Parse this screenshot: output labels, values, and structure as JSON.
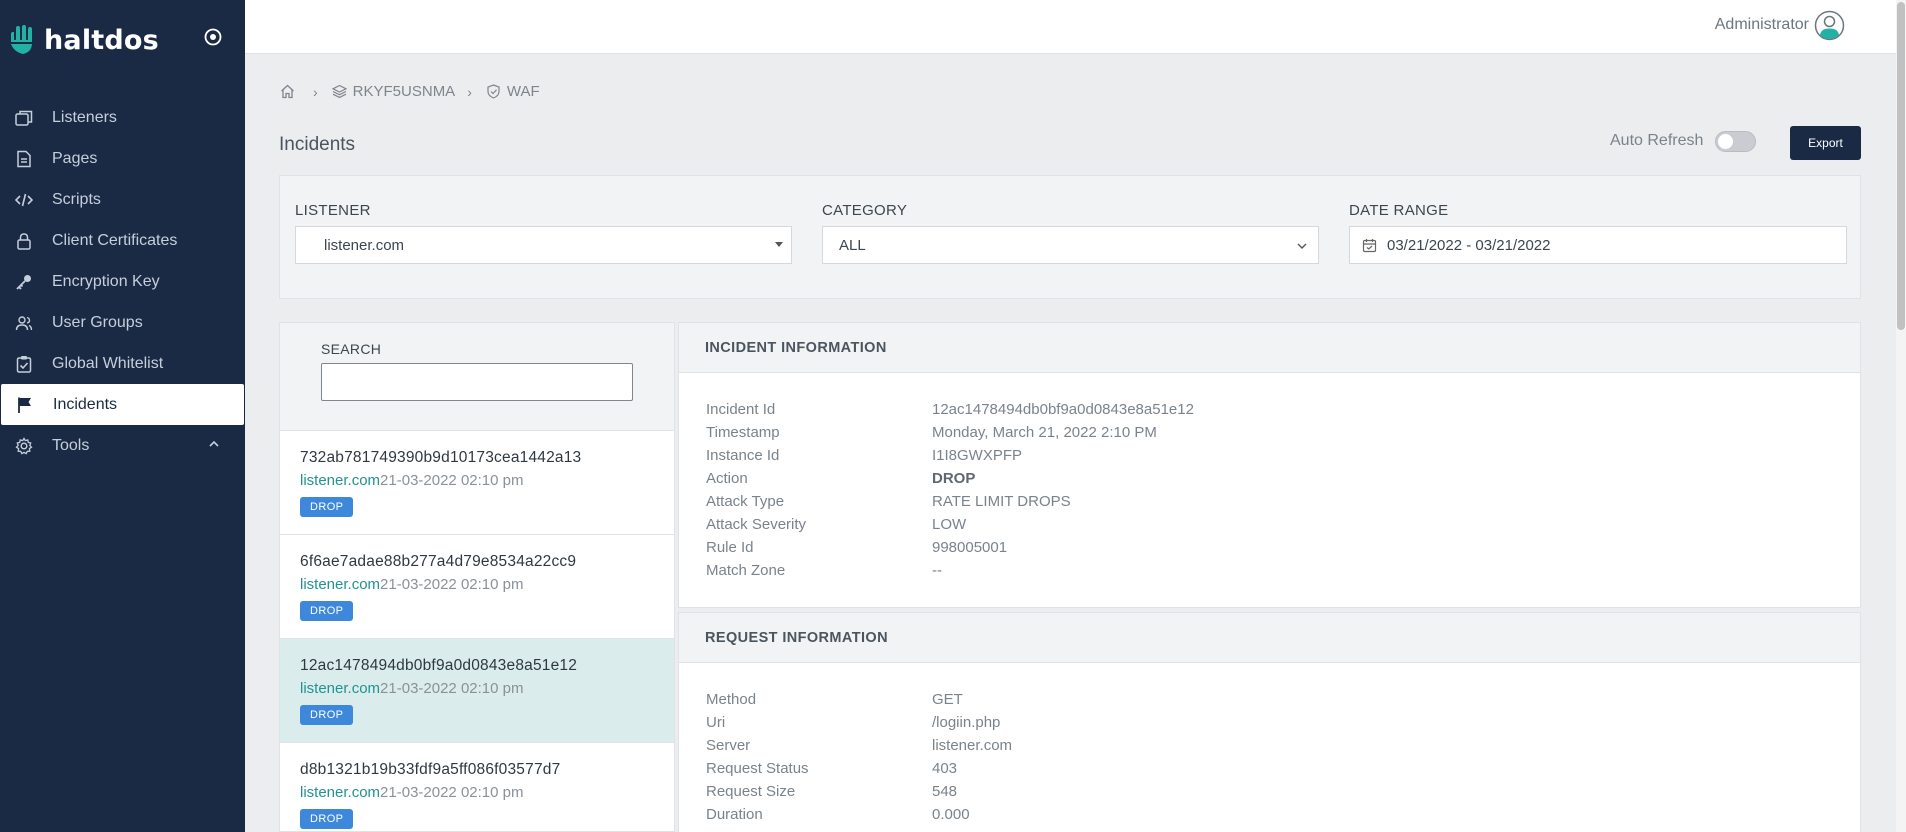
{
  "app": {
    "brand": "haltdos"
  },
  "sidebar": {
    "items": [
      {
        "label": "Listeners",
        "icon": "layers-window-icon"
      },
      {
        "label": "Pages",
        "icon": "document-icon"
      },
      {
        "label": "Scripts",
        "icon": "code-icon"
      },
      {
        "label": "Client Certificates",
        "icon": "lock-icon"
      },
      {
        "label": "Encryption Key",
        "icon": "key-icon"
      },
      {
        "label": "User Groups",
        "icon": "users-icon"
      },
      {
        "label": "Global Whitelist",
        "icon": "clipboard-check-icon"
      },
      {
        "label": "Incidents",
        "icon": "flag-icon",
        "active": true
      },
      {
        "label": "Tools",
        "icon": "gear-icon"
      }
    ]
  },
  "header": {
    "user": "Administrator"
  },
  "breadcrumb": {
    "home": "home-icon",
    "instance": "RKYF5USNMA",
    "section": "WAF"
  },
  "page": {
    "title": "Incidents",
    "auto_refresh_label": "Auto Refresh",
    "auto_refresh_on": false,
    "export_label": "Export"
  },
  "filters": {
    "listener": {
      "label": "LISTENER",
      "value": "listener.com"
    },
    "category": {
      "label": "CATEGORY",
      "value": "ALL"
    },
    "date_range": {
      "label": "DATE RANGE",
      "value": "03/21/2022 - 03/21/2022"
    }
  },
  "search": {
    "label": "SEARCH",
    "value": ""
  },
  "incidents": [
    {
      "id": "732ab781749390b9d10173cea1442a13",
      "host": "listener.com",
      "time": "21-03-2022 02:10 pm",
      "action": "DROP"
    },
    {
      "id": "6f6ae7adae88b277a4d79e8534a22cc9",
      "host": "listener.com",
      "time": "21-03-2022 02:10 pm",
      "action": "DROP"
    },
    {
      "id": "12ac1478494db0bf9a0d0843e8a51e12",
      "host": "listener.com",
      "time": "21-03-2022 02:10 pm",
      "action": "DROP",
      "selected": true
    },
    {
      "id": "d8b1321b19b33fdf9a5ff086f03577d7",
      "host": "listener.com",
      "time": "21-03-2022 02:10 pm",
      "action": "DROP"
    }
  ],
  "incident_info": {
    "title": "INCIDENT INFORMATION",
    "rows": [
      {
        "k": "Incident Id",
        "v": "12ac1478494db0bf9a0d0843e8a51e12"
      },
      {
        "k": "Timestamp",
        "v": "Monday, March 21, 2022 2:10 PM"
      },
      {
        "k": "Instance Id",
        "v": "I1I8GWXPFP"
      },
      {
        "k": "Action",
        "v": "DROP"
      },
      {
        "k": "Attack Type",
        "v": "RATE LIMIT DROPS"
      },
      {
        "k": "Attack Severity",
        "v": "LOW"
      },
      {
        "k": "Rule Id",
        "v": "998005001"
      },
      {
        "k": "Match Zone",
        "v": "--"
      }
    ]
  },
  "request_info": {
    "title": "REQUEST INFORMATION",
    "rows": [
      {
        "k": "Method",
        "v": "GET"
      },
      {
        "k": "Uri",
        "v": "/logiin.php"
      },
      {
        "k": "Server",
        "v": "listener.com"
      },
      {
        "k": "Request Status",
        "v": "403"
      },
      {
        "k": "Request Size",
        "v": "548"
      },
      {
        "k": "Duration",
        "v": "0.000"
      }
    ]
  },
  "colors": {
    "sidebar": "#1b2a44",
    "accent": "#1f9490",
    "badge": "#3d88db",
    "selected_row": "#dbecec"
  }
}
